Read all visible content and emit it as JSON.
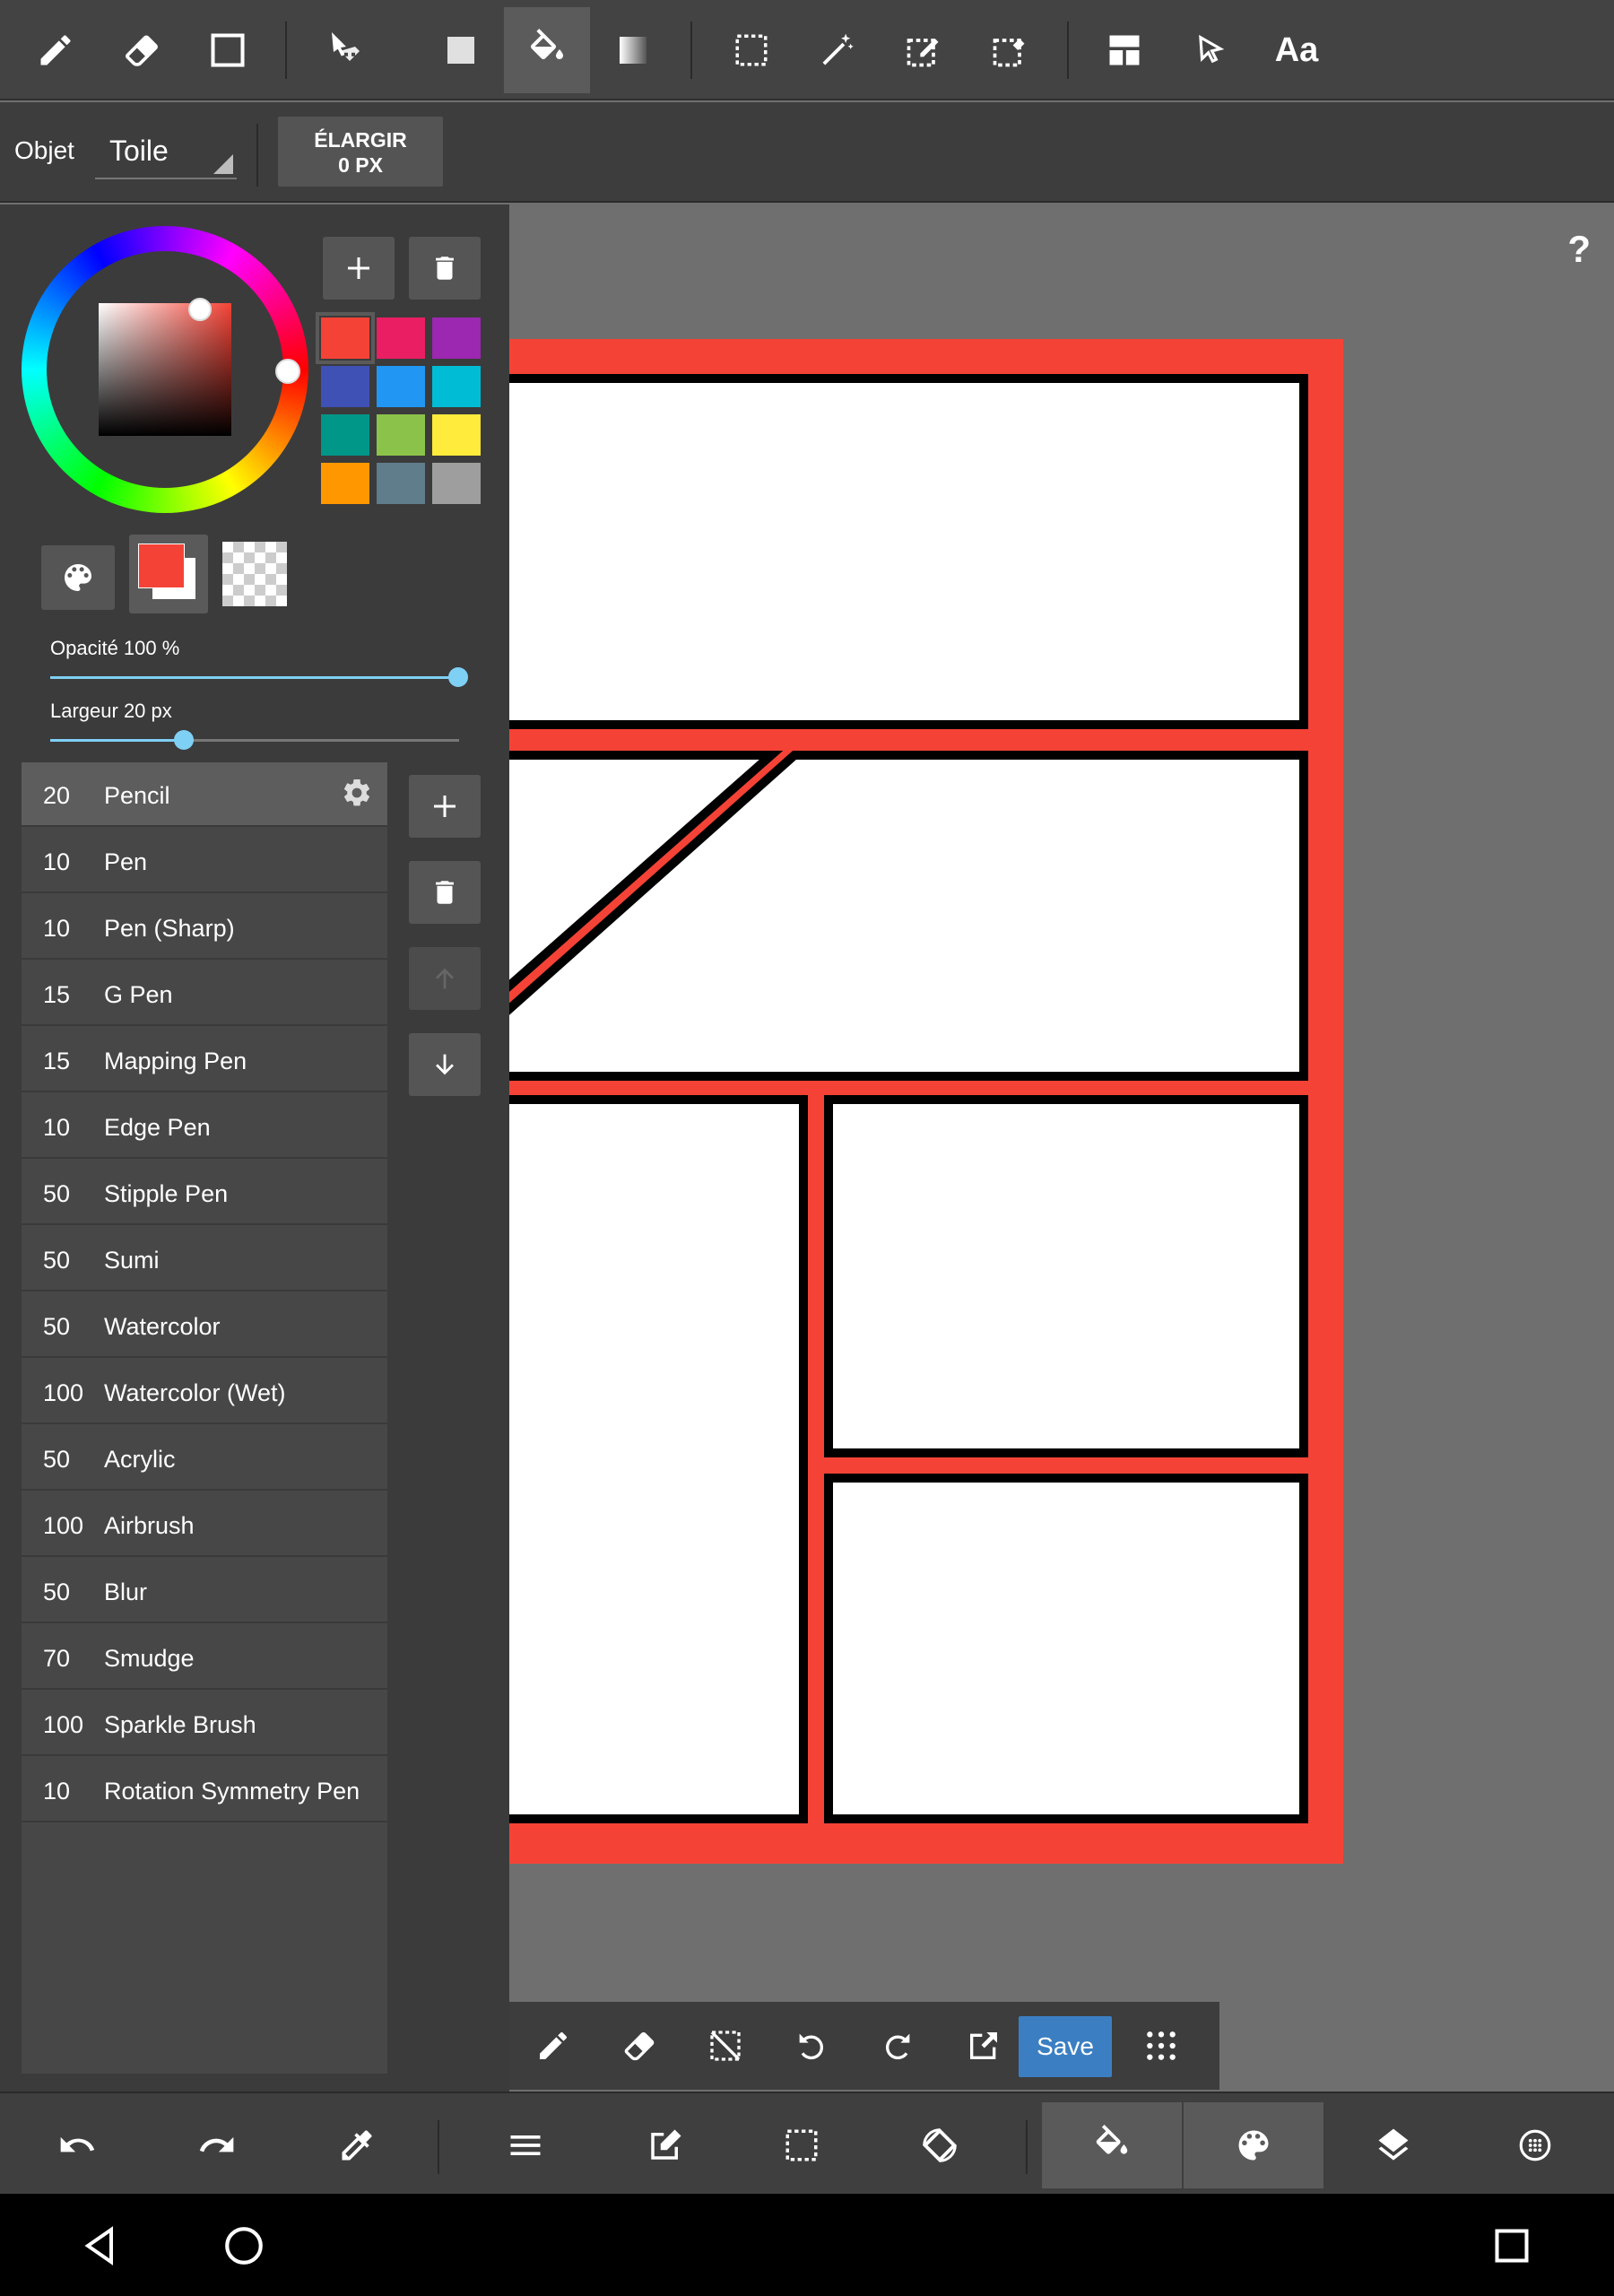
{
  "toolbar": {
    "tools": [
      "pencil-icon",
      "eraser-icon",
      "rectangle-outline-icon",
      "move-icon",
      "fill-rect-icon",
      "bucket-icon",
      "gradient-icon",
      "select-rect-icon",
      "magic-wand-icon",
      "select-pen-icon",
      "select-eraser-icon",
      "panel-divide-icon",
      "pointer-icon"
    ],
    "text_tool_label": "Aa",
    "active_tool": "bucket-icon"
  },
  "options": {
    "object_label": "Objet",
    "object_value": "Toile",
    "expand_label": "ÉLARGIR",
    "expand_value": "0 PX"
  },
  "colors": {
    "accent": "#3b7fc2",
    "current": "#f44336",
    "palette": [
      "#f44336",
      "#e91e63",
      "#9c27b0",
      "#3f51b5",
      "#2196f3",
      "#00bcd4",
      "#009688",
      "#8bc34a",
      "#ffeb3b",
      "#ff9800",
      "#607d8b",
      "#9e9e9e"
    ]
  },
  "sliders": {
    "opacity_label": "Opacité 100 %",
    "opacity_value": 1.0,
    "width_label": "Largeur 20 px",
    "width_value": 0.33
  },
  "brushes": [
    {
      "size": "20",
      "name": "Pencil"
    },
    {
      "size": "10",
      "name": "Pen"
    },
    {
      "size": "10",
      "name": "Pen (Sharp)"
    },
    {
      "size": "15",
      "name": "G Pen"
    },
    {
      "size": "15",
      "name": "Mapping Pen"
    },
    {
      "size": "10",
      "name": "Edge Pen"
    },
    {
      "size": "50",
      "name": "Stipple Pen"
    },
    {
      "size": "50",
      "name": "Sumi"
    },
    {
      "size": "50",
      "name": "Watercolor"
    },
    {
      "size": "100",
      "name": "Watercolor (Wet)"
    },
    {
      "size": "50",
      "name": "Acrylic"
    },
    {
      "size": "100",
      "name": "Airbrush"
    },
    {
      "size": "50",
      "name": "Blur"
    },
    {
      "size": "70",
      "name": "Smudge"
    },
    {
      "size": "100",
      "name": "Sparkle Brush"
    },
    {
      "size": "10",
      "name": "Rotation Symmetry Pen"
    }
  ],
  "canvas": {
    "help_label": "?",
    "frame_color": "#f44336"
  },
  "mini_toolbar": {
    "save_label": "Save"
  },
  "bottom_bar": {
    "items": [
      "undo-icon",
      "redo-icon",
      "eyedropper-icon",
      "menu-icon",
      "edit-icon",
      "selection-icon",
      "rotate-canvas-icon",
      "bucket-icon",
      "palette-icon",
      "layers-icon",
      "settings-icon"
    ]
  },
  "nav": {
    "items": [
      "back-icon",
      "home-icon",
      "recents-icon"
    ]
  }
}
